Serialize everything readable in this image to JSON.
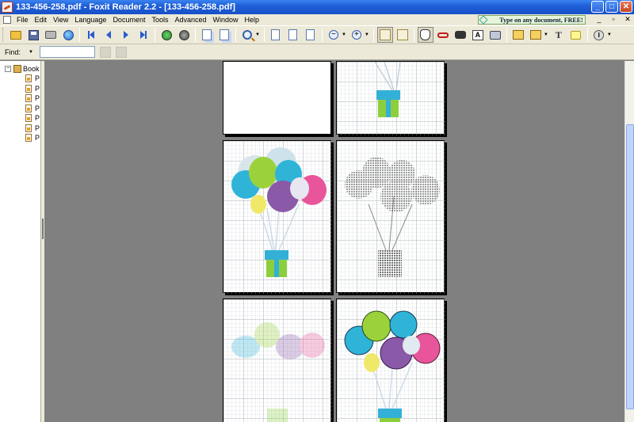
{
  "window": {
    "title": "133-456-258.pdf - Foxit Reader 2.2 - [133-456-258.pdf]",
    "minimize": "_",
    "maximize": "□",
    "close": "✕"
  },
  "menu": {
    "items": [
      "File",
      "Edit",
      "View",
      "Language",
      "Document",
      "Tools",
      "Advanced",
      "Window",
      "Help"
    ],
    "ad_banner": "Type on any document, FREE!",
    "mdi_buttons": [
      "_",
      "▫",
      "✕"
    ]
  },
  "toolbar": {
    "icons": [
      "open-icon",
      "save-icon",
      "print-icon",
      "email-icon",
      "first-page-icon",
      "prev-page-icon",
      "next-page-icon",
      "last-page-icon",
      "go-back-icon",
      "go-forward-icon",
      "rotate-left-icon",
      "rotate-right-icon",
      "zoom-icon",
      "single-page-icon",
      "continuous-icon",
      "facing-icon",
      "zoom-out-icon",
      "zoom-in-icon",
      "bookmark-panel-icon",
      "thumbnail-icon",
      "hand-tool-icon",
      "loupe-icon",
      "find-icon",
      "select-text-icon",
      "snapshot-icon",
      "typewriter-icon",
      "highlight-icon",
      "text-tool-icon",
      "note-icon",
      "info-icon"
    ],
    "text_icon_label": "T",
    "info_label": "i",
    "select_text_label": "A"
  },
  "find": {
    "label": "Find:",
    "value": ""
  },
  "bookmarks": {
    "root_label": "Book",
    "items": [
      "P",
      "P",
      "P",
      "P",
      "P",
      "P",
      "P"
    ]
  },
  "colors": {
    "title_bar": "#1f5fd8",
    "chrome": "#ece9d8",
    "workspace": "#808080",
    "balloon_cyan": "#2fb4d8",
    "balloon_green": "#9bd23c",
    "balloon_purple": "#8a5aa8",
    "balloon_pink": "#e8559a",
    "balloon_yellow": "#f0e868",
    "gift_green": "#8ccf3c"
  }
}
